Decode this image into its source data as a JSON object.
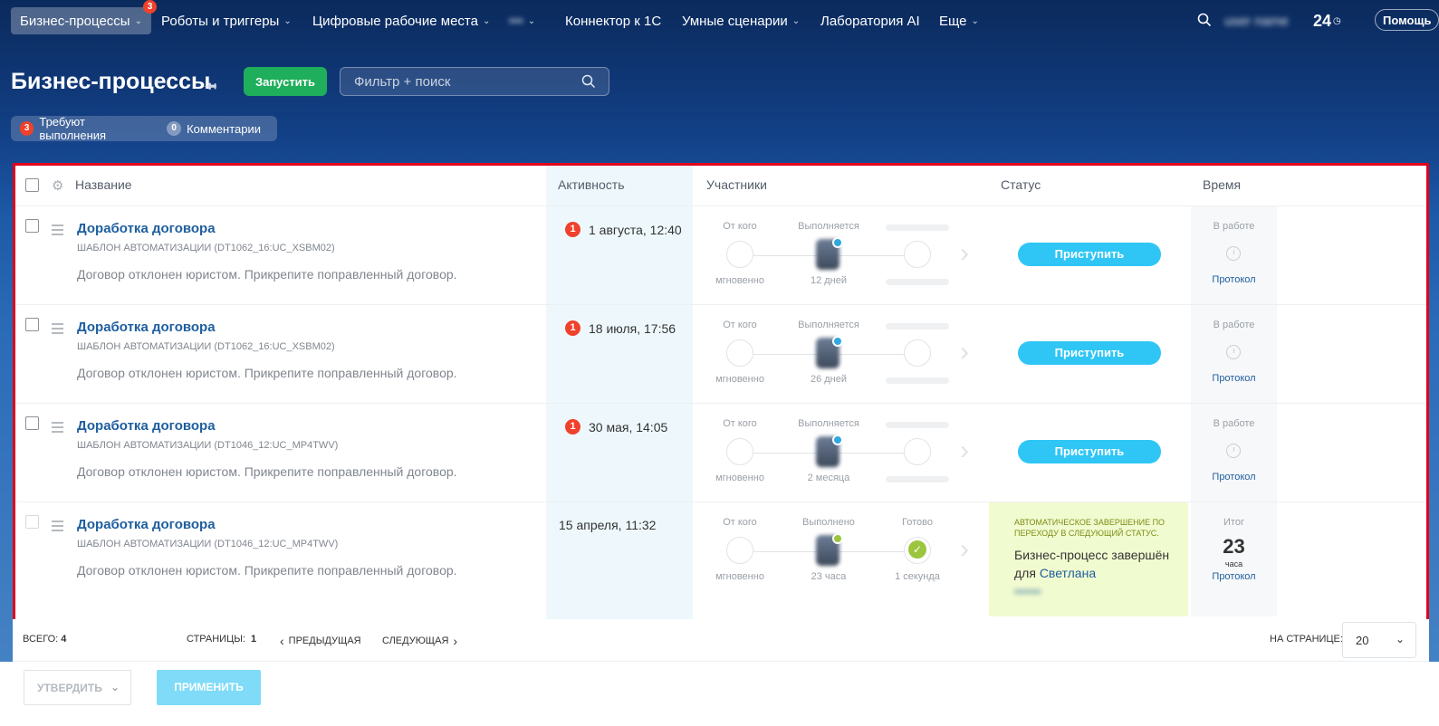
{
  "nav": {
    "items": [
      {
        "label": "Бизнес-процессы",
        "badge": "3"
      },
      {
        "label": "Роботы и триггеры"
      },
      {
        "label": "Цифровые рабочие места"
      },
      {
        "label": "•••"
      },
      {
        "label": "Коннектор к 1С"
      },
      {
        "label": "Умные сценарии"
      },
      {
        "label": "Лаборатория AI"
      },
      {
        "label": "Еще"
      }
    ],
    "user": "user name",
    "b24": "24",
    "help": "Помощь"
  },
  "header": {
    "title": "Бизнес-процессы",
    "run_label": "Запустить",
    "search_placeholder": "Фильтр + поиск"
  },
  "counters": [
    {
      "count": "3",
      "label": "Требуют выполнения"
    },
    {
      "count": "0",
      "label": "Комментарии"
    }
  ],
  "table": {
    "columns": [
      "Название",
      "Активность",
      "Участники",
      "Статус",
      "Время"
    ],
    "rows": [
      {
        "title": "Доработка договора",
        "template": "Шаблон автоматизации (DT1062_16:UC_XSBM02)",
        "desc": "Договор отклонен юристом. Прикрепите поправленный договор.",
        "activity_badge": "1",
        "activity": "1 августа, 12:40",
        "from_label": "От кого",
        "from_sub": "мгновенно",
        "exec_label": "Выполняется",
        "exec_sub": "12 дней",
        "action": "Приступить",
        "time_label": "В работе",
        "time_link": "Протокол"
      },
      {
        "title": "Доработка договора",
        "template": "Шаблон автоматизации (DT1062_16:UC_XSBM02)",
        "desc": "Договор отклонен юристом. Прикрепите поправленный договор.",
        "activity_badge": "1",
        "activity": "18 июля, 17:56",
        "from_label": "От кого",
        "from_sub": "мгновенно",
        "exec_label": "Выполняется",
        "exec_sub": "26 дней",
        "action": "Приступить",
        "time_label": "В работе",
        "time_link": "Протокол"
      },
      {
        "title": "Доработка договора",
        "template": "Шаблон автоматизации (DT1046_12:UC_MP4TWV)",
        "desc": "Договор отклонен юристом. Прикрепите поправленный договор.",
        "activity_badge": "1",
        "activity": "30 мая, 14:05",
        "from_label": "От кого",
        "from_sub": "мгновенно",
        "exec_label": "Выполняется",
        "exec_sub": "2 месяца",
        "action": "Приступить",
        "time_label": "В работе",
        "time_link": "Протокол"
      },
      {
        "title": "Доработка договора",
        "template": "Шаблон автоматизации (DT1046_12:UC_MP4TWV)",
        "desc": "Договор отклонен юристом. Прикрепите поправленный договор.",
        "activity": "15 апреля, 11:32",
        "from_label": "От кого",
        "from_sub": "мгновенно",
        "exec_label": "Выполнено",
        "exec_sub": "23 часа",
        "done_label": "Готово",
        "done_sub": "1 секунда",
        "status_small": "Автоматическое завершение по переходу в следующий статус.",
        "status_text": "Бизнес-процесс завершён для",
        "status_name": "Светлана",
        "status_name_hidden": "••••••",
        "time_label": "Итог",
        "time_value": "23",
        "time_unit": "часа",
        "time_link": "Протокол"
      }
    ]
  },
  "footer": {
    "total_label": "Всего:",
    "total": "4",
    "pages_label": "Страницы:",
    "pages": "1",
    "prev": "Предыдущая",
    "next": "Следующая",
    "per_page_label": "На странице:",
    "per_page": "20"
  },
  "actions": {
    "approve": "Утвердить",
    "apply": "Применить"
  },
  "colors": {
    "accent_red": "#e2001a",
    "run_green": "#1fae5b",
    "start_blue": "#2fc6f6",
    "link_blue": "#1e5e9f"
  }
}
